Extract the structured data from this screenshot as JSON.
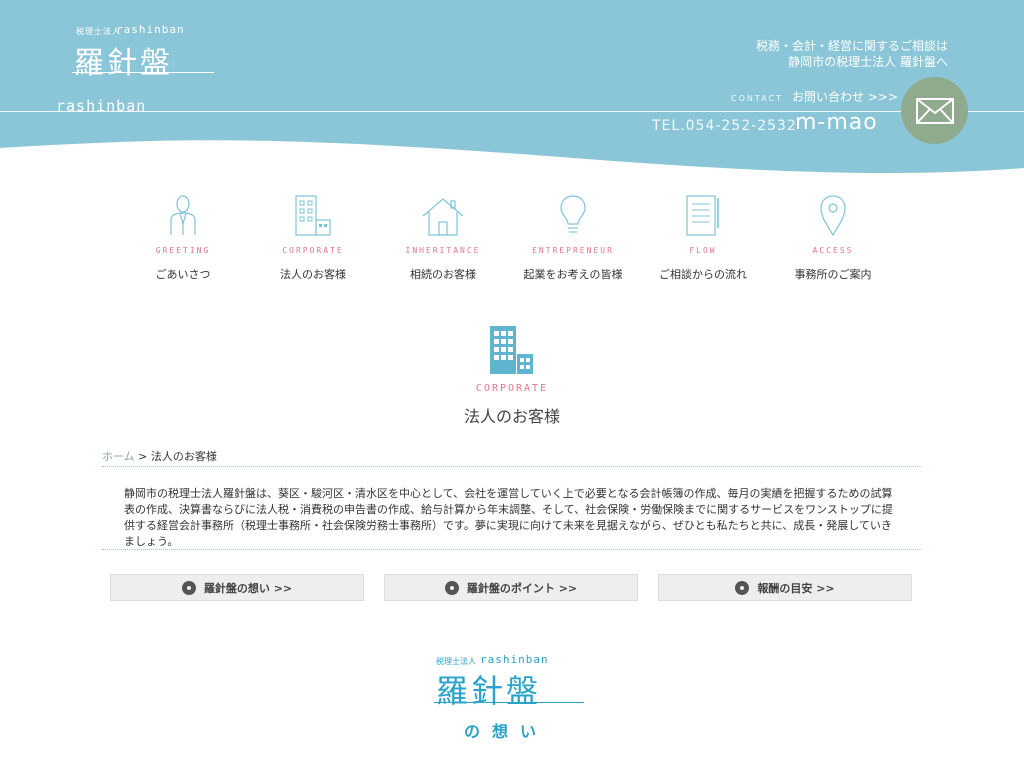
{
  "header": {
    "logo": {
      "corp_label": "税理士法人",
      "roman_small": "rashinban",
      "kanji": "羅針盤",
      "roman_big": "rashinban"
    },
    "tagline_line1": "税務・会計・経営に関するご相談は",
    "tagline_line2": "静岡市の税理士法人 羅針盤へ",
    "contact_en": "CONTACT",
    "contact_jp": "お問い合わせ >>>",
    "tel": "TEL.054-252-2532",
    "brand": "m-mao",
    "mail_icon": "envelope-icon",
    "colors": {
      "header_bg": "#8ac6d8",
      "mail_circle": "#8faa8c"
    }
  },
  "nav": {
    "items": [
      {
        "en": "GREETING",
        "jp": "ごあいさつ",
        "icon": "person-icon"
      },
      {
        "en": "CORPORATE",
        "jp": "法人のお客様",
        "icon": "building-icon"
      },
      {
        "en": "INHERITANCE",
        "jp": "相続のお客様",
        "icon": "house-icon"
      },
      {
        "en": "ENTREPRENEUR",
        "jp": "起業をお考えの皆様",
        "icon": "lightbulb-icon"
      },
      {
        "en": "FLOW",
        "jp": "ご相談からの流れ",
        "icon": "notebook-icon"
      },
      {
        "en": "ACCESS",
        "jp": "事務所のご案内",
        "icon": "map-pin-icon"
      }
    ]
  },
  "section": {
    "en": "CORPORATE",
    "jp": "法人のお客様",
    "icon": "building-icon"
  },
  "breadcrumb": {
    "home": "ホーム",
    "sep": " > ",
    "current": "法人のお客様"
  },
  "intro": "静岡市の税理士法人羅針盤は、葵区・駿河区・清水区を中心として、会社を運営していく上で必要となる会計帳簿の作成、毎月の実績を把握するための試算表の作成、決算書ならびに法人税・消費税の申告書の作成、給与計算から年末調整、そして、社会保険・労働保険までに関するサービスをワンストップに提供する経営会計事務所（税理士事務所・社会保険労務士事務所）です。夢に実現に向けて未来を見据えながら、ぜひとも私たちと共に、成長・発展していきましょう。",
  "buttons": [
    {
      "label": "羅針盤の想い >>"
    },
    {
      "label": "羅針盤のポイント >>"
    },
    {
      "label": "報酬の目安 >>"
    }
  ],
  "bottom_logo": {
    "corp_label": "税理士法人",
    "roman_small": "rashinban",
    "kanji": "羅針盤",
    "subtitle": "の想い"
  },
  "colors": {
    "accent_pink": "#e0788a",
    "accent_blue": "#2aa3c9",
    "icon_blue": "#7fc3d8"
  }
}
